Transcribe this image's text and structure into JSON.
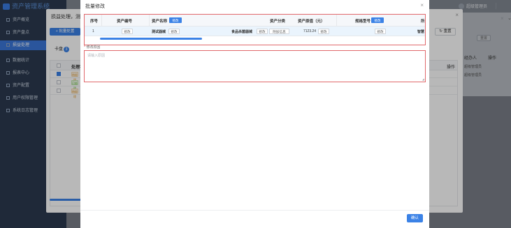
{
  "app": {
    "logo_text": "资产管理系统",
    "nav": [
      {
        "label": "资产概览"
      },
      {
        "label": "资产盘点"
      },
      {
        "label": "损益处理",
        "active": true
      },
      {
        "label": "数据统计"
      },
      {
        "label": "报表中心"
      },
      {
        "label": "资产配置"
      },
      {
        "label": "用户权限管理"
      },
      {
        "label": "系统日志管理"
      }
    ],
    "user_name": "超级管理员",
    "bg_panel": {
      "reset_label": "重置",
      "col_handler": "经办人",
      "col_action": "操作",
      "rows": [
        "超级管理员",
        "超级管理员"
      ]
    }
  },
  "dialog1": {
    "title": "损益处理，测试",
    "add_button": "批量处置",
    "reset_button": "重置",
    "tab_label": "卡盘",
    "tab_count": "3",
    "table": {
      "col_status": "处理状态",
      "col_action": "操作",
      "rows": [
        {
          "status": "待处理",
          "type": "warn",
          "checked": true
        },
        {
          "status": "已处理",
          "type": "ok",
          "checked": false
        },
        {
          "status": "待处理",
          "type": "warn",
          "checked": false
        }
      ]
    }
  },
  "dialog2": {
    "title": "批量修改",
    "columns": {
      "seq": "序号",
      "asset_code": "资产编号",
      "asset_name": "资产名称",
      "asset_category": "资产分类",
      "asset_value": "资产原值（元）",
      "spec_model": "规格型号",
      "overflow": "所"
    },
    "modify_label": "修改",
    "row": {
      "seq": "1",
      "asset_name": "测试器械",
      "asset_category": "食品杀菌器械",
      "extra_info_button": "附加信息",
      "asset_value": "7123.24",
      "overflow_value": "智慧"
    },
    "reason_label": "修改原因",
    "reason_required_mark": "*",
    "reason_placeholder": "请输入原因",
    "confirm_button": "确认"
  }
}
